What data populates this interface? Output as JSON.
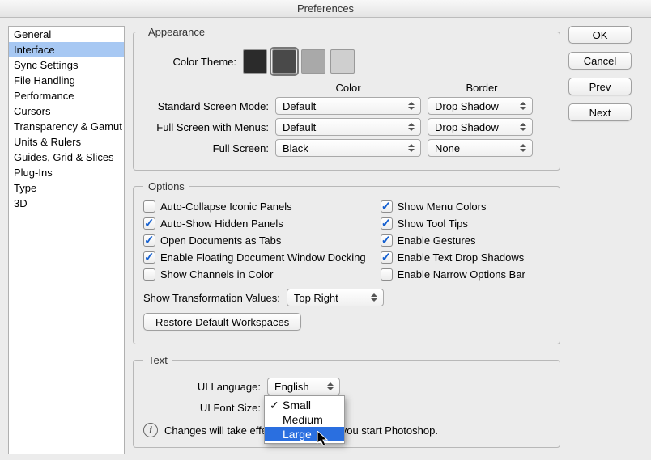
{
  "title": "Preferences",
  "sidebar": {
    "items": [
      {
        "label": "General"
      },
      {
        "label": "Interface"
      },
      {
        "label": "Sync Settings"
      },
      {
        "label": "File Handling"
      },
      {
        "label": "Performance"
      },
      {
        "label": "Cursors"
      },
      {
        "label": "Transparency & Gamut"
      },
      {
        "label": "Units & Rulers"
      },
      {
        "label": "Guides, Grid & Slices"
      },
      {
        "label": "Plug-Ins"
      },
      {
        "label": "Type"
      },
      {
        "label": "3D"
      }
    ],
    "selected_index": 1
  },
  "buttons": {
    "ok": "OK",
    "cancel": "Cancel",
    "prev": "Prev",
    "next": "Next"
  },
  "appearance": {
    "legend": "Appearance",
    "color_theme_label": "Color Theme:",
    "swatches": [
      "#2b2b2b",
      "#494949",
      "#a9a9a9",
      "#cfcfcf"
    ],
    "selected_swatch": 1,
    "color_header": "Color",
    "border_header": "Border",
    "rows": [
      {
        "label": "Standard Screen Mode:",
        "color": "Default",
        "border": "Drop Shadow"
      },
      {
        "label": "Full Screen with Menus:",
        "color": "Default",
        "border": "Drop Shadow"
      },
      {
        "label": "Full Screen:",
        "color": "Black",
        "border": "None"
      }
    ]
  },
  "options": {
    "legend": "Options",
    "left": [
      {
        "label": "Auto-Collapse Iconic Panels",
        "checked": false
      },
      {
        "label": "Auto-Show Hidden Panels",
        "checked": true
      },
      {
        "label": "Open Documents as Tabs",
        "checked": true
      },
      {
        "label": "Enable Floating Document Window Docking",
        "checked": true
      },
      {
        "label": "Show Channels in Color",
        "checked": false
      }
    ],
    "right": [
      {
        "label": "Show Menu Colors",
        "checked": true
      },
      {
        "label": "Show Tool Tips",
        "checked": true
      },
      {
        "label": "Enable Gestures",
        "checked": true
      },
      {
        "label": "Enable Text Drop Shadows",
        "checked": true
      },
      {
        "label": "Enable Narrow Options Bar",
        "checked": false
      }
    ],
    "transform_label": "Show Transformation Values:",
    "transform_value": "Top Right",
    "restore_btn": "Restore Default Workspaces"
  },
  "text": {
    "legend": "Text",
    "ui_language_label": "UI Language:",
    "ui_language_value": "English",
    "ui_font_size_label": "UI Font Size:",
    "ui_font_size_value": "Small",
    "ui_font_size_options": [
      "Small",
      "Medium",
      "Large"
    ],
    "ui_font_size_selected": 0,
    "ui_font_size_highlight": 2,
    "note": "Changes will take effect the next time you start Photoshop."
  }
}
